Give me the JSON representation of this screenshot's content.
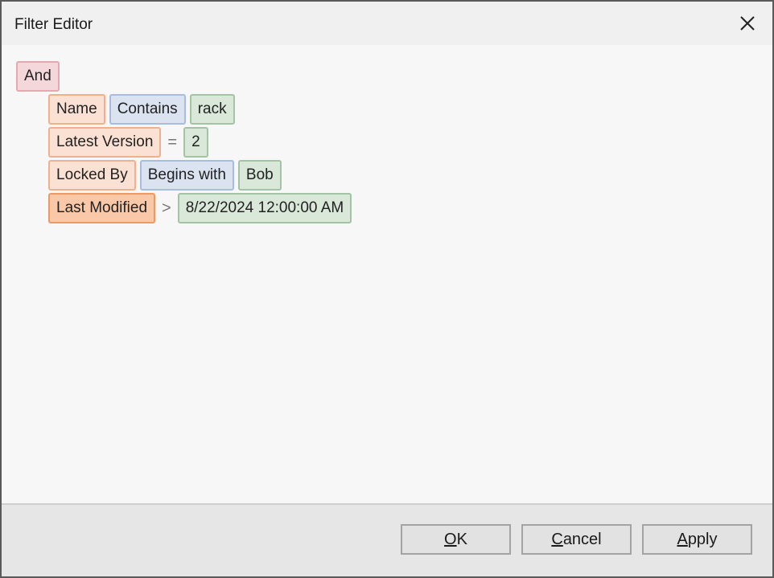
{
  "window": {
    "title": "Filter Editor"
  },
  "filter": {
    "group_operator": "And",
    "conditions": [
      {
        "field": "Name",
        "operator": "Contains",
        "value": "rack"
      },
      {
        "field": "Latest Version",
        "operator_symbol": "=",
        "value": "2"
      },
      {
        "field": "Locked By",
        "operator": "Begins with",
        "value": "Bob"
      },
      {
        "field": "Last Modified",
        "operator_symbol": ">",
        "value": "8/22/2024 12:00:00 AM",
        "selected": true
      }
    ]
  },
  "footer": {
    "ok": {
      "accel": "O",
      "rest": "K"
    },
    "cancel": {
      "accel": "C",
      "rest": "ancel"
    },
    "apply": {
      "accel": "A",
      "rest": "pply"
    }
  },
  "colors": {
    "group": "#f4d7da",
    "field": "#fbe1d3",
    "operator": "#dbe3f1",
    "value": "#dae8da"
  }
}
